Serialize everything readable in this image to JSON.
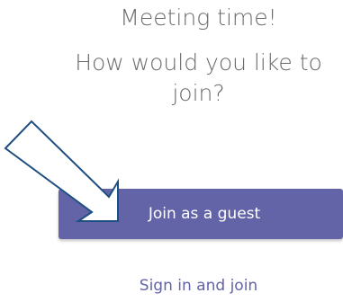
{
  "prompt": {
    "line1": "Meeting time!",
    "line2": "How would you like to",
    "line3": "join?"
  },
  "buttons": {
    "join_as_guest": "Join as a guest",
    "sign_in_and_join": "Sign in and join"
  },
  "colors": {
    "accent": "#6264a7",
    "heading_text": "#6b6b6b",
    "arrow_stroke": "#1f4f80"
  },
  "icons": {
    "pointer": "annotation-arrow-icon"
  }
}
